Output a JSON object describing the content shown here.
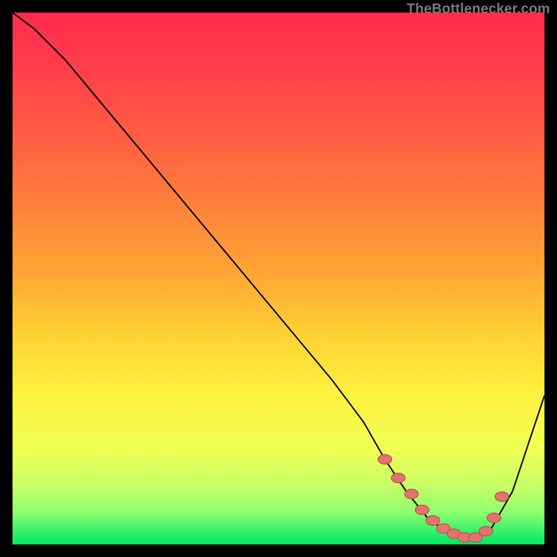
{
  "watermark": "TheBottlenecker.com",
  "colors": {
    "frame": "#000000",
    "curve": "#000000",
    "dot_fill": "#e2736e",
    "dot_stroke": "#bd4e49",
    "gradient_stops": [
      {
        "offset": 0.0,
        "color": "#ff2b4c"
      },
      {
        "offset": 0.1,
        "color": "#ff3d4b"
      },
      {
        "offset": 0.22,
        "color": "#ff5a44"
      },
      {
        "offset": 0.35,
        "color": "#ff7d3c"
      },
      {
        "offset": 0.48,
        "color": "#ffa335"
      },
      {
        "offset": 0.6,
        "color": "#ffcf33"
      },
      {
        "offset": 0.72,
        "color": "#fff23f"
      },
      {
        "offset": 0.82,
        "color": "#f2ff55"
      },
      {
        "offset": 0.89,
        "color": "#c6ff65"
      },
      {
        "offset": 0.94,
        "color": "#8dff6f"
      },
      {
        "offset": 0.975,
        "color": "#39f06a"
      },
      {
        "offset": 1.0,
        "color": "#00e862"
      }
    ]
  },
  "chart_data": {
    "type": "line",
    "title": "",
    "xlabel": "",
    "ylabel": "",
    "xlim": [
      0,
      100
    ],
    "ylim": [
      0,
      100
    ],
    "grid": false,
    "legend": false,
    "series": [
      {
        "name": "bottleneck-curve",
        "x": [
          0,
          4,
          10,
          20,
          30,
          40,
          50,
          60,
          66,
          70,
          74,
          78,
          82,
          86,
          90,
          94,
          100
        ],
        "y": [
          100,
          97,
          91,
          79,
          67,
          55,
          43,
          31,
          23,
          16,
          10,
          5,
          2,
          1,
          3,
          10,
          28
        ]
      }
    ],
    "markers": {
      "name": "optimal-range-dots",
      "x": [
        70,
        72.5,
        75,
        77,
        79,
        81,
        83,
        85,
        87,
        89,
        90.5,
        92
      ],
      "y": [
        16,
        12.5,
        9.5,
        6.5,
        4.5,
        3,
        2,
        1.3,
        1.3,
        2.5,
        5,
        9
      ]
    }
  }
}
